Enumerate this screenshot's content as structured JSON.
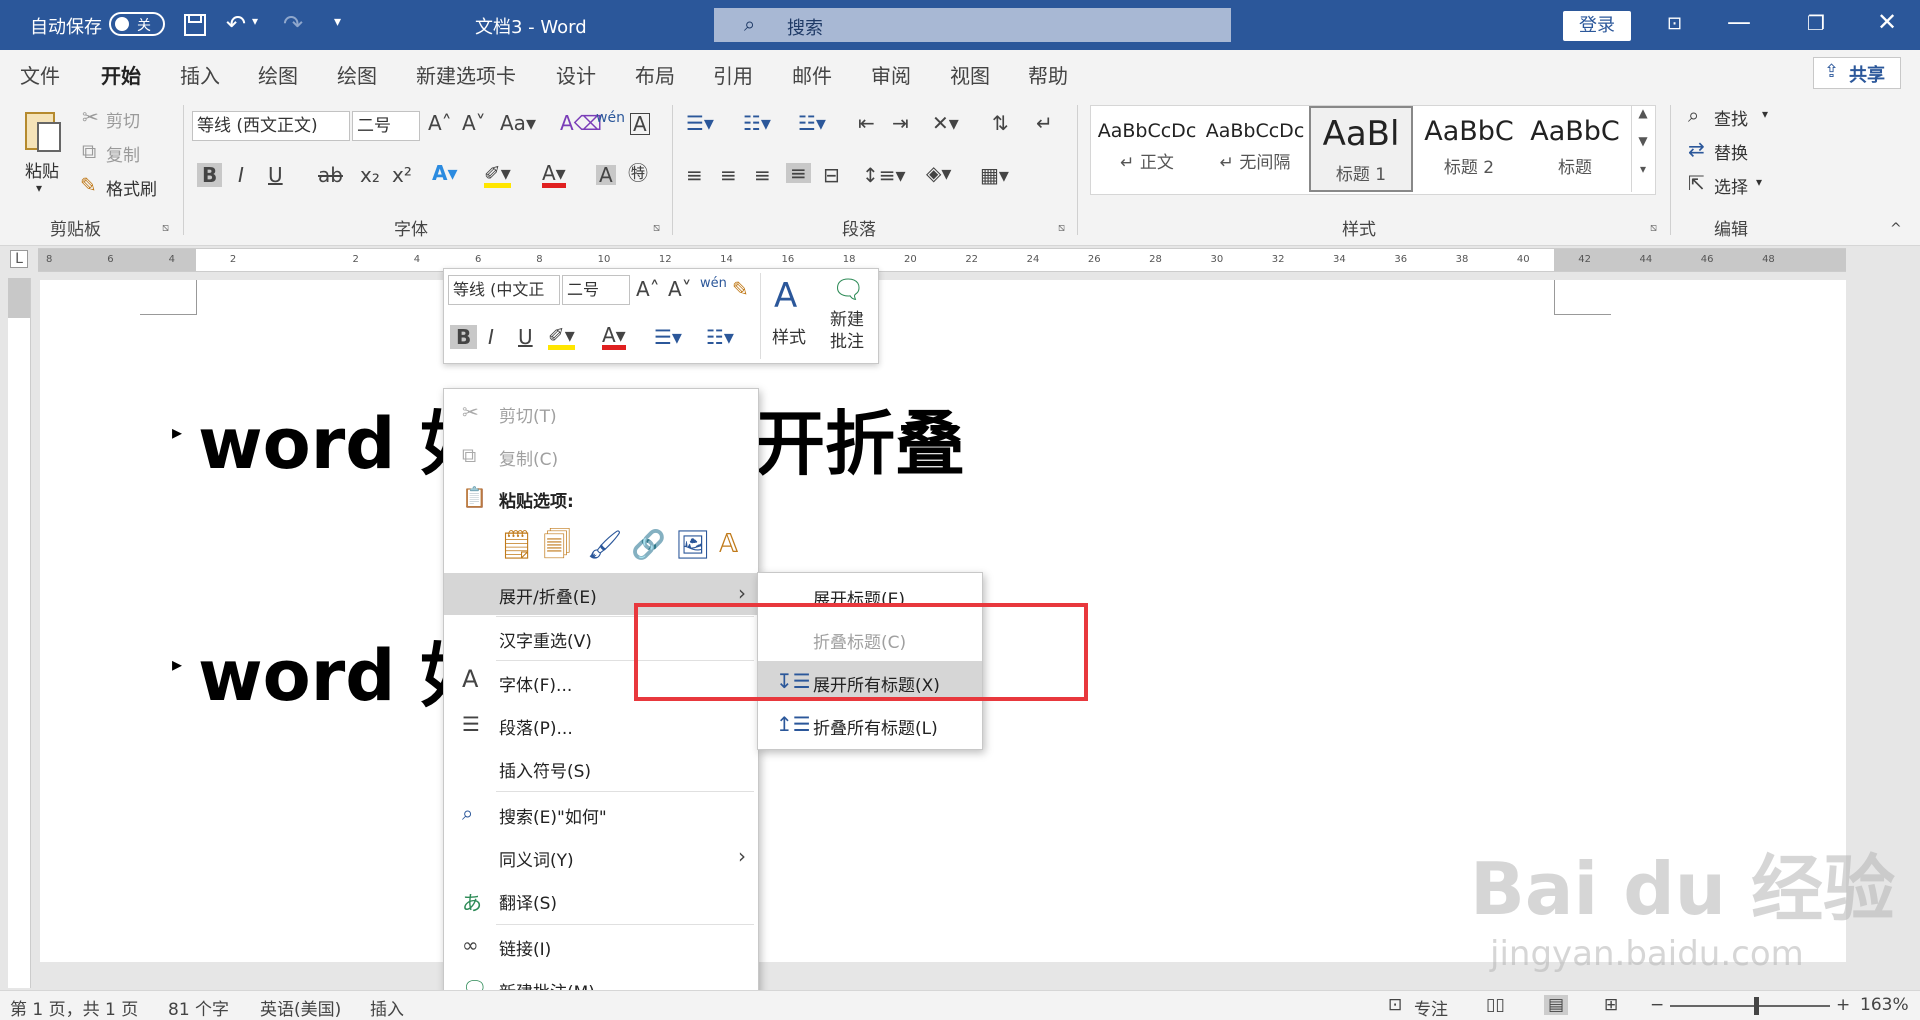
{
  "titlebar": {
    "autosave_label": "自动保存",
    "autosave_state": "关",
    "doc_title": "文档3  -  Word",
    "search_placeholder": "搜索",
    "login_label": "登录"
  },
  "tabs": [
    "文件",
    "开始",
    "插入",
    "绘图",
    "绘图",
    "新建选项卡",
    "设计",
    "布局",
    "引用",
    "邮件",
    "审阅",
    "视图",
    "帮助"
  ],
  "active_tab": "开始",
  "share_label": "共享",
  "ribbon": {
    "clipboard": {
      "paste": "粘贴",
      "cut": "剪切",
      "copy": "复制",
      "format_painter": "格式刷",
      "group": "剪贴板"
    },
    "font": {
      "font_name": "等线 (西文正文)",
      "font_size": "二号",
      "group": "字体"
    },
    "paragraph": {
      "group": "段落"
    },
    "styles": {
      "items": [
        {
          "sample": "AaBbCcDc",
          "name": "↵ 正文"
        },
        {
          "sample": "AaBbCcDc",
          "name": "↵ 无间隔"
        },
        {
          "sample": "AaBl",
          "name": "标题 1"
        },
        {
          "sample": "AaBbC",
          "name": "标题 2"
        },
        {
          "sample": "AaBbC",
          "name": "标题"
        }
      ],
      "group": "样式"
    },
    "editing": {
      "find": "查找",
      "replace": "替换",
      "select": "选择",
      "group": "编辑"
    }
  },
  "ruler_ticks": [
    "8",
    "6",
    "4",
    "2",
    "",
    "2",
    "4",
    "6",
    "8",
    "10",
    "12",
    "14",
    "16",
    "18",
    "20",
    "22",
    "24",
    "26",
    "28",
    "30",
    "32",
    "34",
    "36",
    "38",
    "40",
    "42",
    "44",
    "46",
    "48"
  ],
  "document": {
    "heading1_left": "word 如",
    "heading1_right": "开折叠",
    "heading2_left": "word 如"
  },
  "mini_toolbar": {
    "font_name": "等线 (中文正",
    "font_size": "二号",
    "styles_label": "样式",
    "new_comment_label": "新建\n批注"
  },
  "context_menu": {
    "items": [
      {
        "label": "剪切(T)",
        "icon": "scissors-icon",
        "disabled": true
      },
      {
        "label": "复制(C)",
        "icon": "copy-icon",
        "disabled": true
      },
      {
        "label": "粘贴选项:",
        "icon": "paste-icon"
      },
      {
        "label": "展开/折叠(E)",
        "submenu": true,
        "hover": true
      },
      {
        "label": "汉字重选(V)"
      },
      {
        "label": "字体(F)...",
        "icon": "font-icon"
      },
      {
        "label": "段落(P)...",
        "icon": "paragraph-icon"
      },
      {
        "label": "插入符号(S)"
      },
      {
        "label": "搜索(E)\"如何\"",
        "icon": "search-icon"
      },
      {
        "label": "同义词(Y)",
        "submenu": true
      },
      {
        "label": "翻译(S)",
        "icon": "translate-icon"
      },
      {
        "label": "链接(I)",
        "icon": "link-icon"
      },
      {
        "label": "新建批注(M)",
        "icon": "comment-icon"
      }
    ]
  },
  "submenu": {
    "items": [
      {
        "label": "展开标题(E)"
      },
      {
        "label": "折叠标题(C)",
        "disabled": true
      },
      {
        "label": "展开所有标题(X)",
        "hover": true
      },
      {
        "label": "折叠所有标题(L)"
      }
    ]
  },
  "statusbar": {
    "page": "第 1 页，共 1 页",
    "words": "81 个字",
    "language": "英语(美国)",
    "mode": "插入",
    "focus": "专注",
    "zoom": "163%"
  },
  "watermark": {
    "brand": "Bai du 经验",
    "url": "jingyan.baidu.com"
  },
  "colors": {
    "word_blue": "#2b579a",
    "highlight_box": "#e8383d"
  }
}
